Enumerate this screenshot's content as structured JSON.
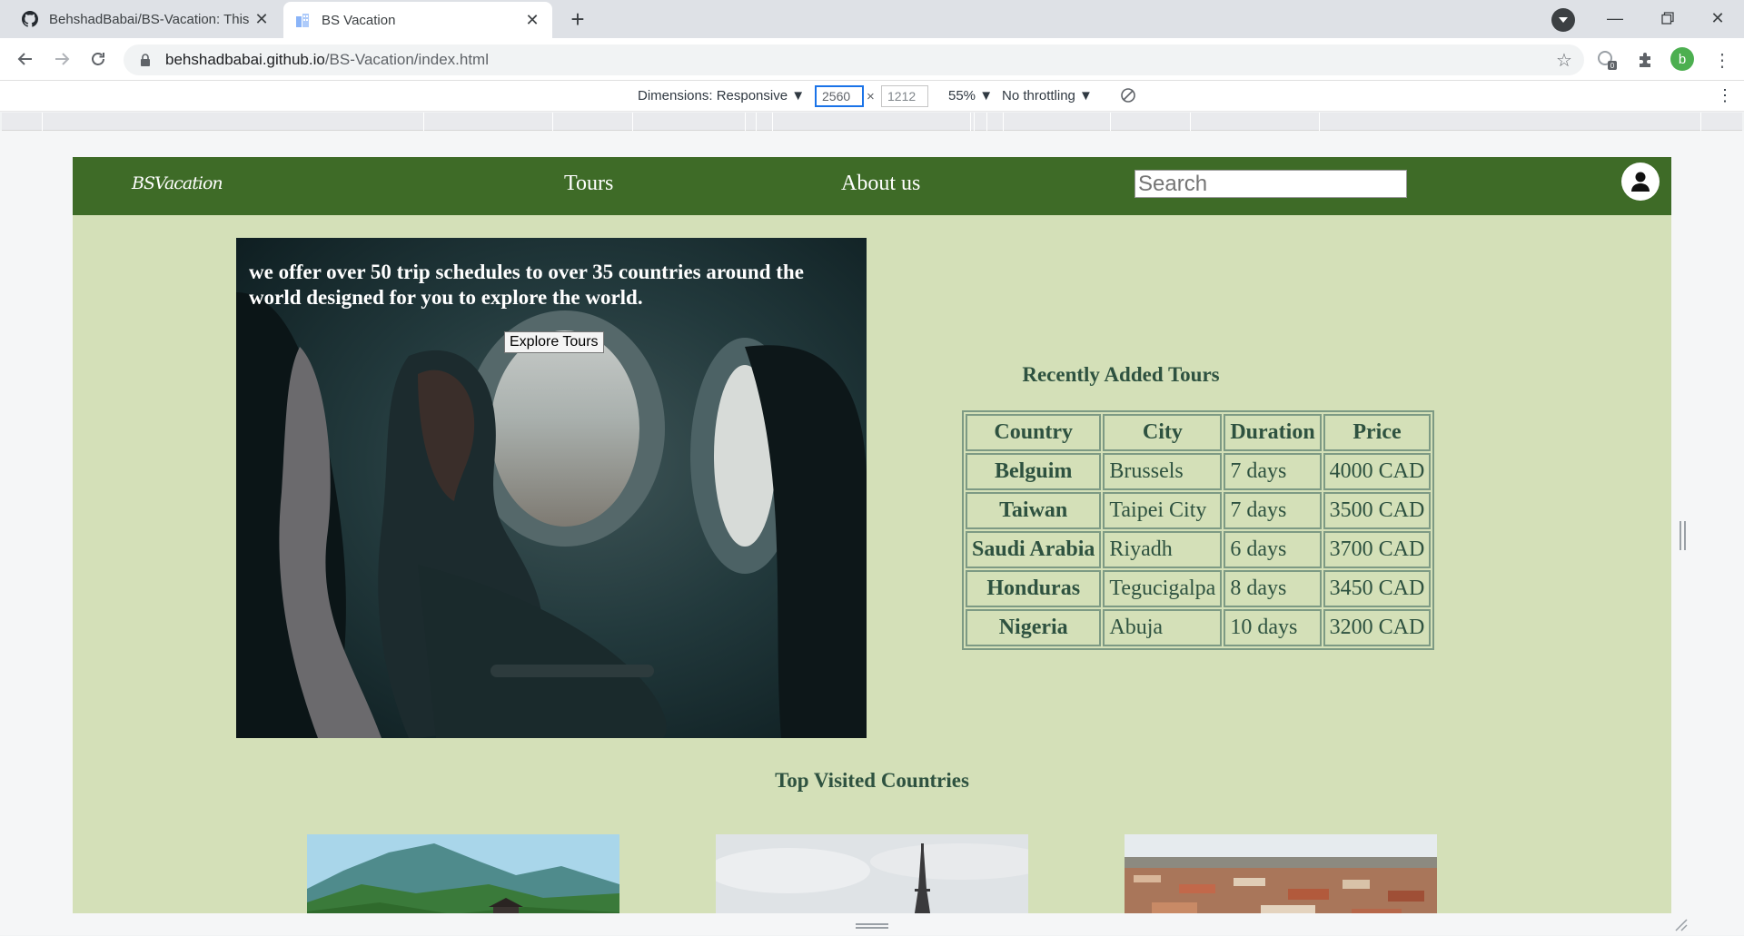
{
  "browser": {
    "tabs": [
      {
        "title": "BehshadBabai/BS-Vacation: This",
        "active": false
      },
      {
        "title": "BS Vacation",
        "active": true
      }
    ],
    "url_host": "behshadbabai.github.io",
    "url_path": "/BS-Vacation/index.html",
    "profile_initial": "b",
    "extension_badge": "0"
  },
  "devtools": {
    "dimensions_label": "Dimensions: Responsive ▼",
    "width": "2560",
    "times": "×",
    "height": "1212",
    "zoom": "55% ▼",
    "throttling": "No throttling ▼"
  },
  "site": {
    "logo": "BSVacation",
    "nav": {
      "tours": "Tours",
      "about": "About us"
    },
    "search_placeholder": "Search",
    "hero": {
      "text": "we offer over 50 trip schedules to over 35 countries around the world designed for you to explore the world.",
      "button": "Explore Tours"
    },
    "recent": {
      "title": "Recently Added Tours",
      "headers": [
        "Country",
        "City",
        "Duration",
        "Price"
      ],
      "rows": [
        [
          "Belguim",
          "Brussels",
          "7 days",
          "4000 CAD"
        ],
        [
          "Taiwan",
          "Taipei City",
          "7 days",
          "3500 CAD"
        ],
        [
          "Saudi Arabia",
          "Riyadh",
          "6 days",
          "3700 CAD"
        ],
        [
          "Honduras",
          "Tegucigalpa",
          "8 days",
          "3450 CAD"
        ],
        [
          "Nigeria",
          "Abuja",
          "10 days",
          "3200 CAD"
        ]
      ]
    },
    "top_title": "Top Visited Countries"
  },
  "colors": {
    "nav_green": "#3e6b27",
    "page_green": "#d4e0b8",
    "text_dark_green": "#2e5240"
  }
}
